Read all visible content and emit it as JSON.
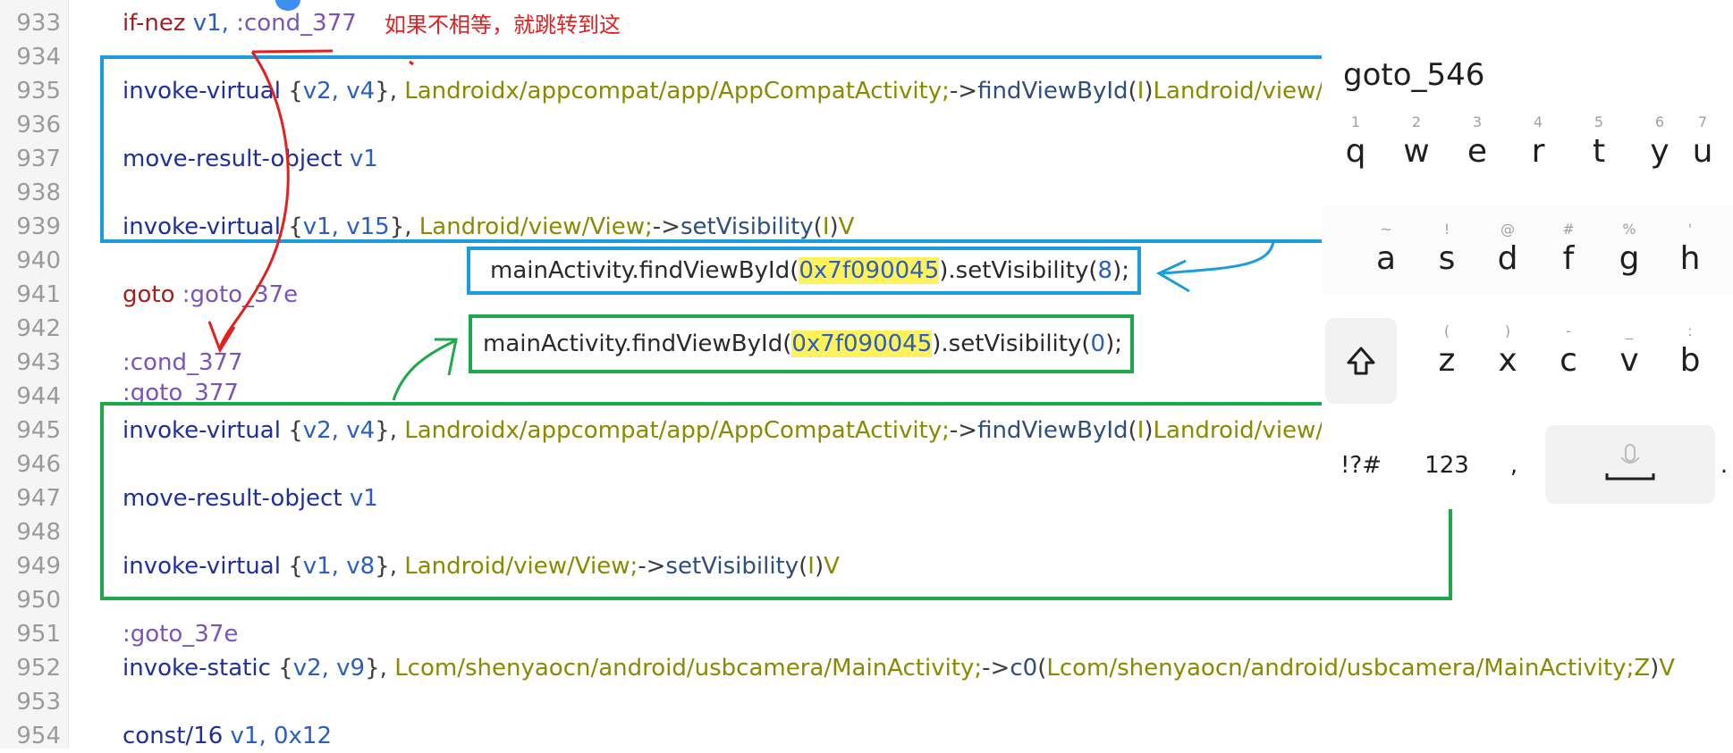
{
  "editor": {
    "line_numbers": [
      "933",
      "934",
      "935",
      "936",
      "937",
      "938",
      "939",
      "940",
      "941",
      "942",
      "943",
      "944",
      "945",
      "946",
      "947",
      "948",
      "949",
      "950",
      "951",
      "952",
      "953",
      "954"
    ],
    "lines": {
      "l933": {
        "ins": "if-nez",
        "r1": "v1,",
        "lbl": ":cond_377"
      },
      "l935": {
        "ins": "invoke-virtual",
        "p1": "{",
        "r1": "v2,",
        "r2": "v4",
        "p2": "},",
        "cls": "Landroidx/appcompat/app/AppCompatActivity;",
        "arrow": "->",
        "mth": "findViewById",
        "sig1": "(",
        "sigI": "I",
        "sig2": ")",
        "ret": "Landroid/view/View;"
      },
      "l937": {
        "ins": "move-result-object",
        "r1": "v1"
      },
      "l939": {
        "ins": "invoke-virtual",
        "p1": "{",
        "r1": "v1,",
        "r2": "v15",
        "p2": "},",
        "cls": "Landroid/view/View;",
        "arrow": "->",
        "mth": "setVisibility",
        "sig1": "(",
        "sigI": "I",
        "sig2": ")",
        "ret": "V"
      },
      "l941": {
        "ins": "goto",
        "lbl": ":goto_37e"
      },
      "l943": {
        "lbl": ":cond_377"
      },
      "l944": {
        "lbl": ":goto_377"
      },
      "l945": {
        "ins": "invoke-virtual",
        "p1": "{",
        "r1": "v2,",
        "r2": "v4",
        "p2": "},",
        "cls": "Landroidx/appcompat/app/AppCompatActivity;",
        "arrow": "->",
        "mth": "findViewById",
        "sig1": "(",
        "sigI": "I",
        "sig2": ")",
        "ret": "Landroid/view/View;"
      },
      "l947": {
        "ins": "move-result-object",
        "r1": "v1"
      },
      "l949": {
        "ins": "invoke-virtual",
        "p1": "{",
        "r1": "v1,",
        "r2": "v8",
        "p2": "},",
        "cls": "Landroid/view/View;",
        "arrow": "->",
        "mth": "setVisibility",
        "sig1": "(",
        "sigI": "I",
        "sig2": ")",
        "ret": "V"
      },
      "l951": {
        "lbl": ":goto_37e"
      },
      "l952": {
        "ins": "invoke-static",
        "p1": "{",
        "r1": "v2,",
        "r2": "v9",
        "p2": "},",
        "cls": "Lcom/shenyaocn/android/usbcamera/MainActivity;",
        "arrow": "->",
        "mth": "c0",
        "sig1": "(",
        "sigCls": "Lcom/shenyaocn/android/usbcamera/MainActivity;Z",
        "sig2": ")",
        "ret": "V"
      },
      "l954": {
        "ins": "const/16",
        "r1": "v1,",
        "num": "0x12"
      }
    }
  },
  "annotations": {
    "red_note": "如果不相等，就跳转到这",
    "java_blue": {
      "pre": "mainActivity.findViewById(",
      "id": "0x7f090045",
      "mid": ").setVisibility(",
      "val": "8",
      "post": ");"
    },
    "java_green": {
      "pre": "mainActivity.findViewById(",
      "id": "0x7f090045",
      "mid": ").setVisibility(",
      "val": "0",
      "post": ");"
    }
  },
  "keyboard": {
    "suggestion": "goto_546",
    "row1": [
      {
        "hint": "1",
        "ch": "q"
      },
      {
        "hint": "2",
        "ch": "w"
      },
      {
        "hint": "3",
        "ch": "e"
      },
      {
        "hint": "4",
        "ch": "r"
      },
      {
        "hint": "5",
        "ch": "t"
      },
      {
        "hint": "6",
        "ch": "y"
      },
      {
        "hint": "7",
        "ch": "u"
      }
    ],
    "row2": [
      {
        "hint": "~",
        "ch": "a"
      },
      {
        "hint": "!",
        "ch": "s"
      },
      {
        "hint": "@",
        "ch": "d"
      },
      {
        "hint": "#",
        "ch": "f"
      },
      {
        "hint": "%",
        "ch": "g"
      },
      {
        "hint": "'",
        "ch": "h"
      }
    ],
    "row3": [
      {
        "hint": "(",
        "ch": "z"
      },
      {
        "hint": ")",
        "ch": "x"
      },
      {
        "hint": "-",
        "ch": "c"
      },
      {
        "hint": "_",
        "ch": "v"
      },
      {
        "hint": ":",
        "ch": "b"
      }
    ],
    "symbols_key": "!?#",
    "numbers_key": "123",
    "comma_key": ",",
    "period_key": "."
  },
  "colors": {
    "blue_box": "#1b9ce0",
    "green_box": "#1fa84a",
    "red_note": "#e12020",
    "highlight": "#fff25a"
  }
}
